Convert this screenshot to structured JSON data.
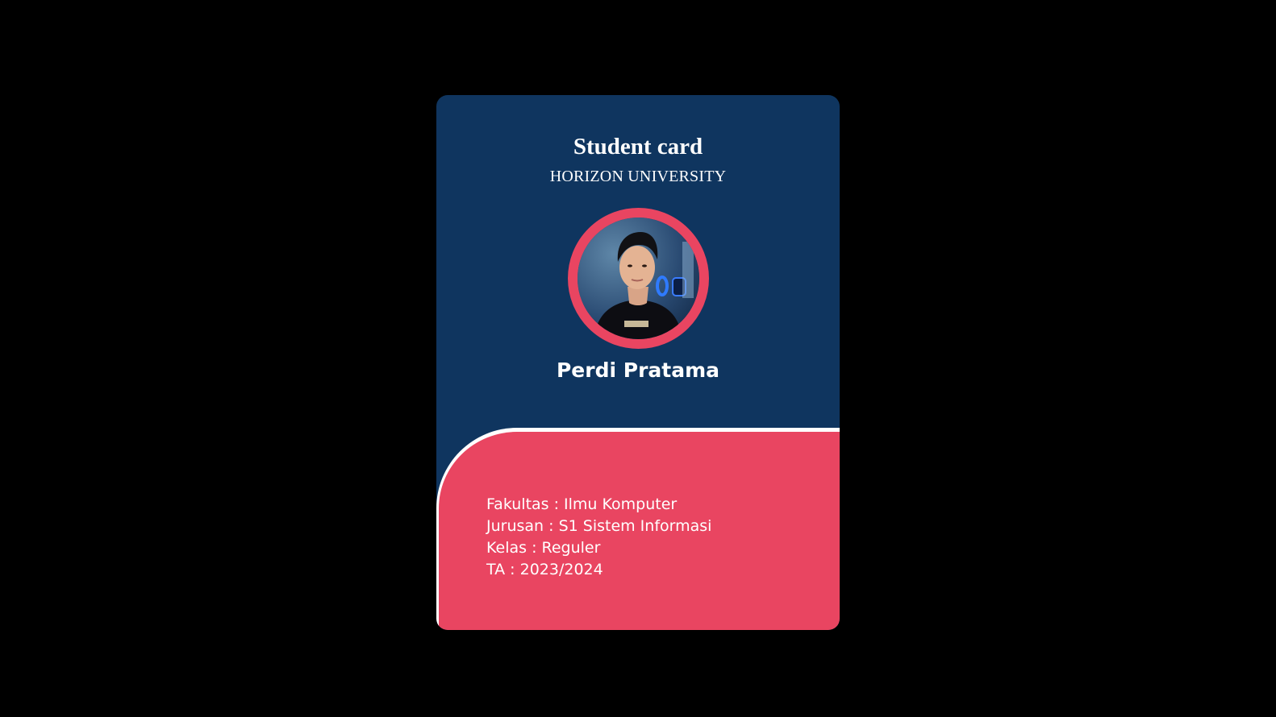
{
  "card": {
    "title": "Student card",
    "university": "HORIZON UNIVERSITY",
    "student_name": "Perdi Pratama",
    "info": [
      {
        "label": "Fakultas",
        "value": "Ilmu Komputer",
        "text": "Fakultas : Ilmu Komputer"
      },
      {
        "label": "Jurusan",
        "value": "S1 Sistem Informasi",
        "text": "Jurusan : S1 Sistem Informasi"
      },
      {
        "label": "Kelas",
        "value": "Reguler",
        "text": "Kelas : Reguler"
      },
      {
        "label": "TA",
        "value": "2023/2024",
        "text": "TA : 2023/2024"
      }
    ]
  },
  "colors": {
    "page_background": "#000000",
    "card_top": "#0f355f",
    "accent": "#e94561",
    "text": "#ffffff"
  },
  "icons": {
    "avatar": "student-photo"
  }
}
